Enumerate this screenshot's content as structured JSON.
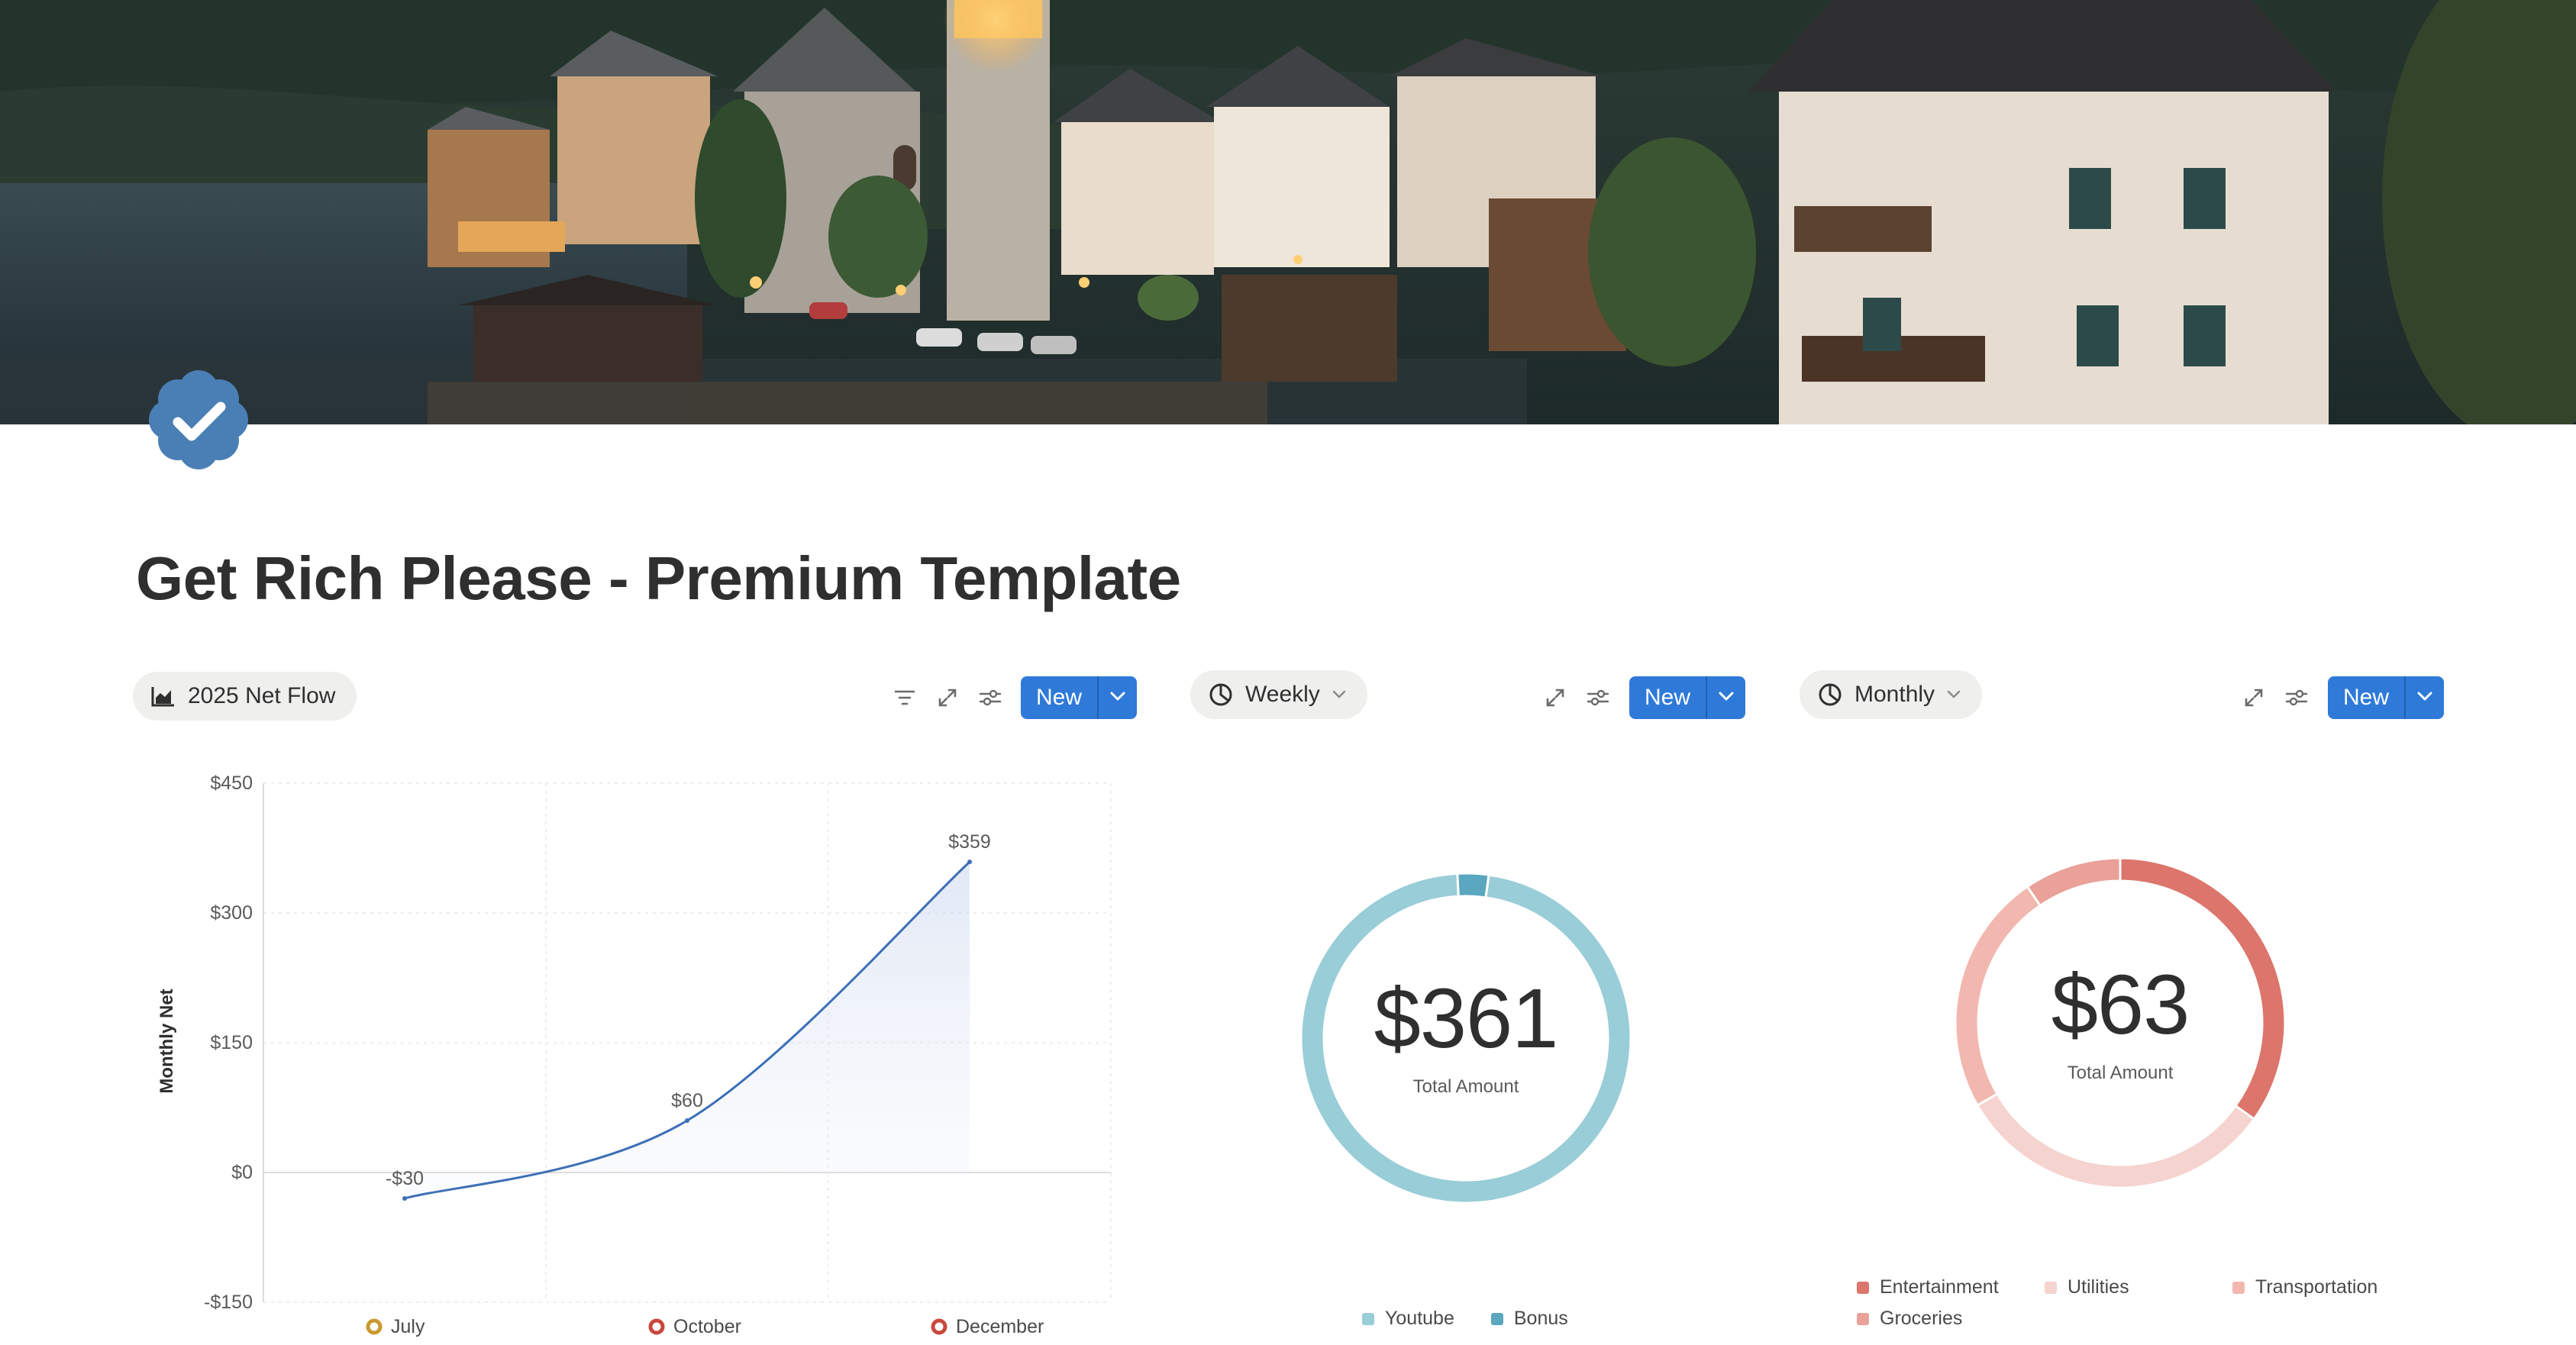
{
  "page": {
    "title": "Get Rich Please - Premium Template",
    "icon": "verified-badge-icon",
    "cover": "lakeside-village-photo"
  },
  "views": [
    {
      "tab_label": "2025 Net Flow",
      "tab_icon": "line-chart-icon",
      "tools": [
        "filter-icon",
        "expand-icon",
        "settings-sliders-icon"
      ],
      "new_label": "New"
    },
    {
      "tab_label": "Weekly",
      "tab_icon": "pie-chart-icon",
      "tools": [
        "expand-icon",
        "settings-sliders-icon"
      ],
      "new_label": "New"
    },
    {
      "tab_label": "Monthly",
      "tab_icon": "pie-chart-icon",
      "tools": [
        "expand-icon",
        "settings-sliders-icon"
      ],
      "new_label": "New"
    }
  ],
  "colors": {
    "accent": "#2f7ad9",
    "line": "#3d6fb6",
    "weekly_youtube": "#99cdd8",
    "weekly_bonus": "#5aa7bf",
    "entertainment": "#dc756b",
    "utilities": "#f5d3cf",
    "transportation": "#f2b7ae",
    "groceries": "#e9a19a"
  },
  "chart_data": [
    {
      "type": "area",
      "ylabel": "Monthly Net",
      "ylim": [
        -150,
        450
      ],
      "yticks": [
        "$450",
        "$300",
        "$150",
        "$0",
        "-$150"
      ],
      "ytick_values": [
        450,
        300,
        150,
        0,
        -150
      ],
      "categories": [
        "July",
        "October",
        "December"
      ],
      "series": [
        {
          "values": [
            -30,
            60,
            359
          ],
          "labels": [
            "-$30",
            "$60",
            "$359"
          ]
        }
      ],
      "legend_markers": [
        "#c99a2e",
        "#c9473d",
        "#c9473d"
      ],
      "grid": true
    },
    {
      "type": "pie",
      "style": "donut",
      "center_value": "$361",
      "center_caption": "Total Amount",
      "series": [
        {
          "name": "Youtube",
          "value": 350
        },
        {
          "name": "Bonus",
          "value": 11
        }
      ]
    },
    {
      "type": "pie",
      "style": "donut",
      "center_value": "$63",
      "center_caption": "Total Amount",
      "series": [
        {
          "name": "Entertainment",
          "value": 22
        },
        {
          "name": "Utilities",
          "value": 20
        },
        {
          "name": "Transportation",
          "value": 15
        },
        {
          "name": "Groceries",
          "value": 6
        }
      ]
    }
  ]
}
